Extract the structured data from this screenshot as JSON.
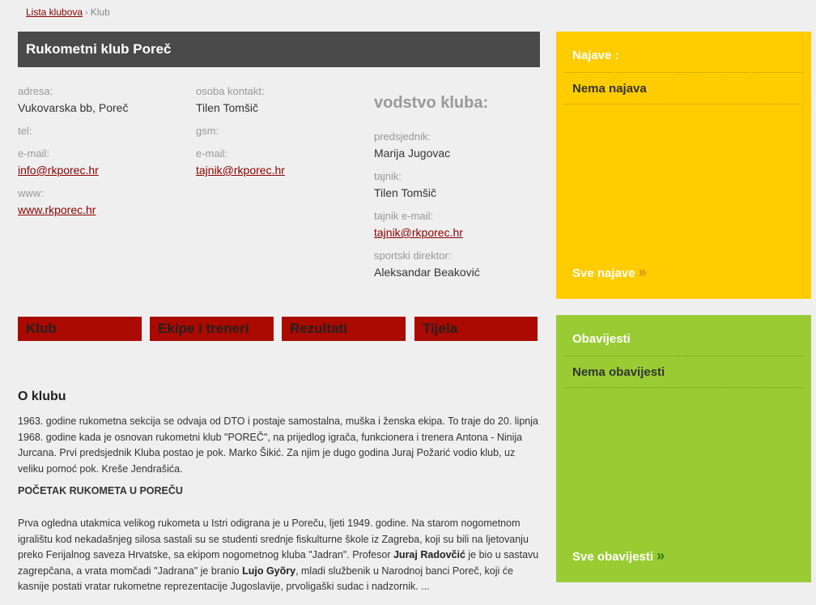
{
  "breadcrumb": {
    "link": "Lista klubova",
    "separator": "›",
    "current": "Klub"
  },
  "club": {
    "name": "Rukometni klub Poreč"
  },
  "info": {
    "col1": {
      "address_label": "adresa:",
      "address": "Vukovarska bb, Poreč",
      "tel_label": "tel:",
      "tel": "",
      "email_label": "e-mail:",
      "email": "info@rkporec.hr",
      "www_label": "www:",
      "www": "www.rkporec.hr"
    },
    "col2": {
      "contact_label": "osoba kontakt:",
      "contact": "Tilen Tomšič",
      "gsm_label": "gsm:",
      "gsm": "",
      "email_label": "e-mail:",
      "email": "tajnik@rkporec.hr"
    },
    "col3": {
      "heading": "vodstvo kluba:",
      "president_label": "predsjednik:",
      "president": "Marija Jugovac",
      "secretary_label": "tajnik:",
      "secretary": "Tilen Tomšič",
      "secretary_email_label": "tajnik e-mail:",
      "secretary_email": "tajnik@rkporec.hr",
      "director_label": "sportski direktor:",
      "director": "Aleksandar Beaković"
    }
  },
  "tabs": [
    "Klub",
    "Ekipe i treneri",
    "Rezultati",
    "Tijela"
  ],
  "content": {
    "title": "O klubu",
    "para1": "1963. godine rukometna sekcija se odvaja od DTO i postaje samostalna, muška i ženska ekipa. To traje do 20. lipnja 1968. godine kada je osnovan rukometni klub \"POREČ\", na prijedlog igrača, funkcionera i trenera Antona - Ninija Jurcana. Prvi predsjednik Kluba postao je pok. Marko Šikić. Za njim je dugo godina Juraj Požarić vodio klub, uz veliku pomoć pok. Kreše Jendrašića.",
    "subheading": "POČETAK RUKOMETA U POREČU",
    "para2_a": "Prva ogledna utakmica velikog rukometa u Istri odigrana je u Poreču, ljeti 1949. godine. Na starom nogometnom igralištu kod nekadašnjeg silosa sastali su se studenti srednje fiskulturne škole iz Zagreba, koji su bili na ljetovanju preko Ferijalnog saveza Hrvatske, sa ekipom nogometnog kluba \"Jadran\". Profesor ",
    "para2_b1": "Juraj Radovčić",
    "para2_c": " je bio u sastavu zagrepčana, a vrata momčadi \"Jadrana\" je branio ",
    "para2_b2": "Lujo Gyõry",
    "para2_d": ", mladi službenik u Narodnoj banci Poreč,  koji će kasnije postati vratar rukometne reprezentacije Jugoslavije, prvoligaški sudac i nadzornik. ..."
  },
  "sidebar": {
    "announcements": {
      "title": "Najave :",
      "empty": "Nema najava",
      "link": "Sve najave",
      "arrow": "»"
    },
    "notices": {
      "title": "Obavijesti",
      "empty": "Nema obavijesti",
      "link": "Sve obavijesti",
      "arrow": "»"
    }
  },
  "colors": {
    "header_bg": "#4a4a4a",
    "tab_bg": "#aa0a00",
    "yellow_box": "#ffcc00",
    "green_box": "#99cc33",
    "link": "#8b0000"
  }
}
